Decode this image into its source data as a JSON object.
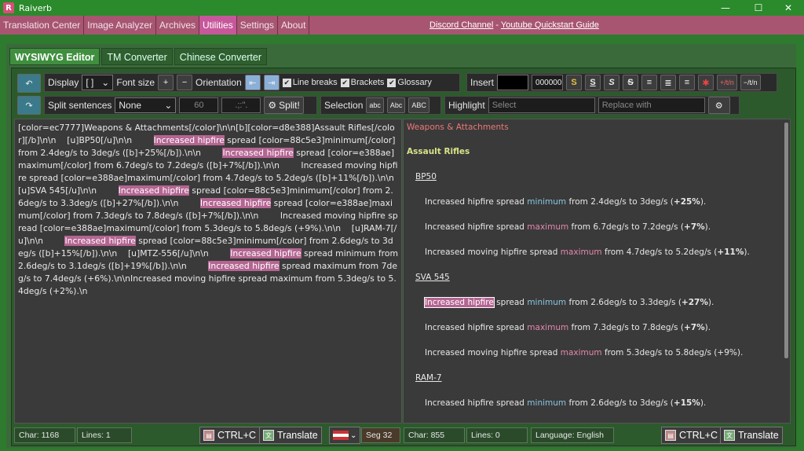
{
  "app": {
    "title": "Raiverb",
    "logo_letter": "R"
  },
  "menu": [
    {
      "label": "Translation Center"
    },
    {
      "label": "Image Analyzer"
    },
    {
      "label": "Archives"
    },
    {
      "label": "Utilities",
      "active": true
    },
    {
      "label": "Settings"
    },
    {
      "label": "About"
    }
  ],
  "links": {
    "discord": "Discord Channel",
    "sep": " - ",
    "guide": "Youtube Quickstart Guide"
  },
  "tabs": [
    {
      "label": "WYSIWYG Editor",
      "active": true
    },
    {
      "label": "TM Converter"
    },
    {
      "label": "Chinese Converter"
    }
  ],
  "toolbar": {
    "display_label": "Display",
    "display_value": "[ ]",
    "fontsize_label": "Font size",
    "plus": "+",
    "minus": "−",
    "orientation_label": "Orientation",
    "linebreaks_label": "Line breaks",
    "brackets_label": "Brackets",
    "glossary_label": "Glossary",
    "insert_label": "Insert",
    "color_code": "000000",
    "fmt_s": "S",
    "fmt_rtn": "+/t/n",
    "fmt_mtn": "−/t/n",
    "split_label": "Split sentences",
    "split_value": "None",
    "split_num": "60",
    "split_chars": ".;:\".",
    "split_btn": "Split!",
    "selection_label": "Selection",
    "sel_lower": "abc",
    "sel_title": "Abc",
    "sel_upper": "ABC",
    "highlight_label": "Highlight",
    "select_placeholder": "Select",
    "replace_placeholder": "Replace with"
  },
  "editor": {
    "segments": [
      {
        "t": "[color=ec7777]Weapons & Attachments[/color]\\n\\n[b][color=d8e388]Assault Rifles[/color][/b]\\n\\n    [u]BP50[/u]\\n\\n        "
      },
      {
        "t": "Increased hipfire",
        "hl": true
      },
      {
        "t": " spread [color=88c5e3]minimum[/color] from 2.4deg/s to 3deg/s ([b]+25%[/b]).\\n\\n        "
      },
      {
        "t": "Increased hipfire",
        "hl": true
      },
      {
        "t": " spread [color=e388ae]maximum[/color] from 6.7deg/s to 7.2deg/s ([b]+7%[/b]).\\n\\n        Increased moving hipfire spread [color=e388ae]maximum[/color] from 4.7deg/s to 5.2deg/s ([b]+11%[/b]).\\n\\n    [u]SVA 545[/u]\\n\\n        "
      },
      {
        "t": "Increased hipfire",
        "hl": true
      },
      {
        "t": " spread [color=88c5e3]minimum[/color] from 2.6deg/s to 3.3deg/s ([b]+27%[/b]).\\n\\n        "
      },
      {
        "t": "Increased hipfire",
        "hl": true
      },
      {
        "t": " spread [color=e388ae]maximum[/color] from 7.3deg/s to 7.8deg/s ([b]+7%[/b]).\\n\\n        Increased moving hipfire spread [color=e388ae]maximum[/color] from 5.3deg/s to 5.8deg/s (+9%).\\n\\n    [u]RAM-7[/u]\\n\\n        "
      },
      {
        "t": "Increased hipfire",
        "hl": true
      },
      {
        "t": " spread [color=88c5e3]minimum[/color] from 2.6deg/s to 3deg/s ([b]+15%[/b]).\\n\\n    [u]MTZ-556[/u]\\n\\n        "
      },
      {
        "t": "Increased hipfire",
        "hl": true
      },
      {
        "t": " spread minimum from 2.6deg/s to 3.1deg/s ([b]+19%[/b]).\\n\\n        "
      },
      {
        "t": "Increased hipfire",
        "hl": true
      },
      {
        "t": " spread maximum from 7deg/s to 7.4deg/s (+6%).\\n\\nIncreased moving hipfire spread maximum from 5.3deg/s to 5.4deg/s (+2%).\\n"
      }
    ]
  },
  "preview": {
    "section": "Weapons & Attachments",
    "group": "Assault Rifles",
    "weapons": [
      {
        "name": "BP50",
        "lines": [
          {
            "pre": "Increased hipfire spread ",
            "kw": "minimum",
            "kwc": "min",
            "post": " from 2.4deg/s to 3deg/s (",
            "b": "+25%",
            "end": ")."
          },
          {
            "pre": "Increased hipfire spread ",
            "kw": "maximum",
            "kwc": "max",
            "post": " from 6.7deg/s to 7.2deg/s (",
            "b": "+7%",
            "end": ")."
          },
          {
            "pre": "Increased moving hipfire spread ",
            "kw": "maximum",
            "kwc": "max",
            "post": " from 4.7deg/s to 5.2deg/s (",
            "b": "+11%",
            "end": ")."
          }
        ]
      },
      {
        "name": "SVA 545",
        "lines": [
          {
            "hlpre": "Increased hipfire",
            "pre": " spread ",
            "kw": "minimum",
            "kwc": "min",
            "post": " from 2.6deg/s to 3.3deg/s (",
            "b": "+27%",
            "end": ")."
          },
          {
            "pre": "Increased hipfire spread ",
            "kw": "maximum",
            "kwc": "max",
            "post": " from 7.3deg/s to 7.8deg/s (",
            "b": "+7%",
            "end": ")."
          },
          {
            "pre": "Increased moving hipfire spread ",
            "kw": "maximum",
            "kwc": "max",
            "post": " from 5.3deg/s to 5.8deg/s (+9%).",
            "b": "",
            "end": ""
          }
        ]
      },
      {
        "name": "RAM-7",
        "lines": [
          {
            "pre": "Increased hipfire spread ",
            "kw": "minimum",
            "kwc": "min",
            "post": " from 2.6deg/s to 3deg/s (",
            "b": "+15%",
            "end": ")."
          }
        ]
      }
    ]
  },
  "status_left": {
    "chars": "Char: 1168",
    "lines": "Lines: 1",
    "copy": "CTRL+C",
    "translate": "Translate",
    "seg": "Seg 32"
  },
  "status_right": {
    "chars": "Char: 855",
    "lines": "Lines: 0",
    "language": "Language: English",
    "copy": "CTRL+C",
    "translate": "Translate"
  },
  "colors": {
    "section": "#ec7777",
    "group": "#d8e388",
    "min": "#88c5e3",
    "max": "#e388ae",
    "highlight": "#b46592"
  }
}
